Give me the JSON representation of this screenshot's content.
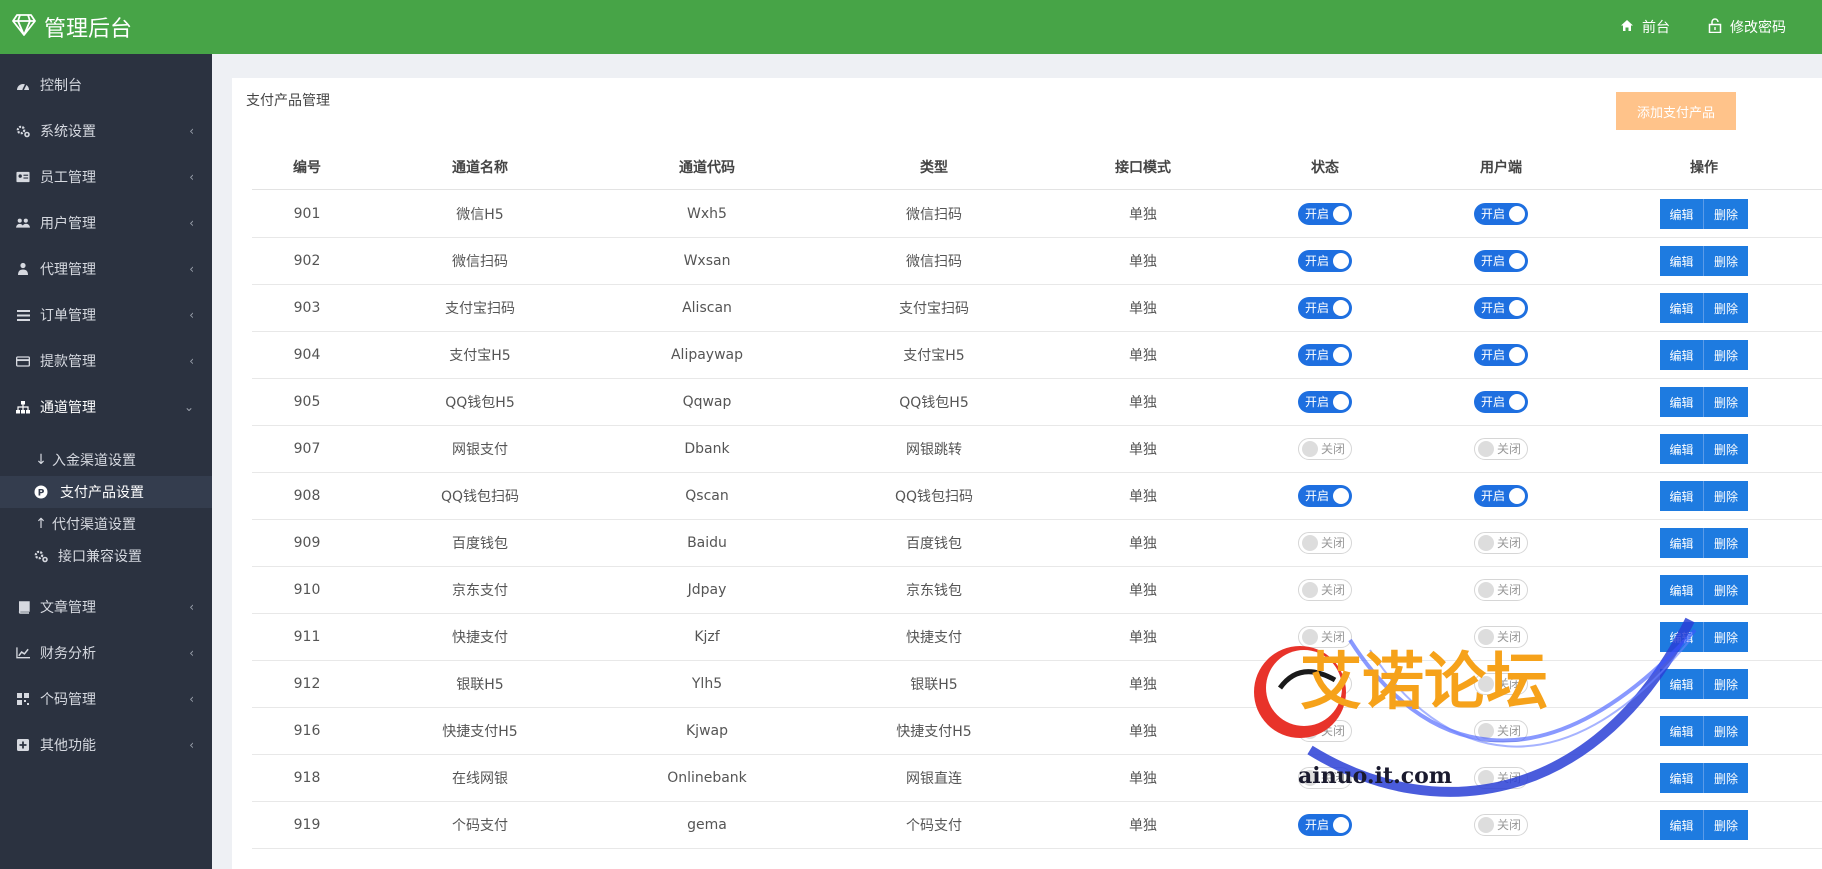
{
  "header": {
    "title": "管理后台",
    "links": {
      "front": "前台",
      "password": "修改密码"
    },
    "color": "#47a447"
  },
  "sidebar": {
    "items": [
      {
        "label": "控制台",
        "icon": "dashboard-icon"
      },
      {
        "label": "系统设置",
        "icon": "cogs-icon"
      },
      {
        "label": "员工管理",
        "icon": "id-card-icon"
      },
      {
        "label": "用户管理",
        "icon": "users-icon"
      },
      {
        "label": "代理管理",
        "icon": "user-tie-icon"
      },
      {
        "label": "订单管理",
        "icon": "list-icon"
      },
      {
        "label": "提款管理",
        "icon": "credit-card-icon"
      },
      {
        "label": "通道管理",
        "icon": "sitemap-icon"
      },
      {
        "label": "文章管理",
        "icon": "book-icon"
      },
      {
        "label": "财务分析",
        "icon": "line-chart-icon"
      },
      {
        "label": "个码管理",
        "icon": "qrcode-icon"
      },
      {
        "label": "其他功能",
        "icon": "plus-square-icon"
      }
    ],
    "sub_items": [
      {
        "label": "入金渠道设置",
        "icon": "arrow-down-icon"
      },
      {
        "label": "支付产品设置",
        "icon": "p-circle-icon"
      },
      {
        "label": "代付渠道设置",
        "icon": "arrow-up-icon"
      },
      {
        "label": "接口兼容设置",
        "icon": "cogs-icon"
      }
    ]
  },
  "panel": {
    "title": "支付产品管理",
    "add_button": "添加支付产品"
  },
  "table": {
    "headers": [
      "编号",
      "通道名称",
      "通道代码",
      "类型",
      "接口模式",
      "状态",
      "用户端",
      "操作"
    ],
    "on_label": "开启",
    "off_label": "关闭",
    "edit_label": "编辑",
    "delete_label": "删除",
    "rows": [
      {
        "id": "901",
        "name": "微信H5",
        "code": "Wxh5",
        "type": "微信扫码",
        "mode": "单独",
        "status": true,
        "client": true
      },
      {
        "id": "902",
        "name": "微信扫码",
        "code": "Wxsan",
        "type": "微信扫码",
        "mode": "单独",
        "status": true,
        "client": true
      },
      {
        "id": "903",
        "name": "支付宝扫码",
        "code": "Aliscan",
        "type": "支付宝扫码",
        "mode": "单独",
        "status": true,
        "client": true
      },
      {
        "id": "904",
        "name": "支付宝H5",
        "code": "Alipaywap",
        "type": "支付宝H5",
        "mode": "单独",
        "status": true,
        "client": true
      },
      {
        "id": "905",
        "name": "QQ钱包H5",
        "code": "Qqwap",
        "type": "QQ钱包H5",
        "mode": "单独",
        "status": true,
        "client": true
      },
      {
        "id": "907",
        "name": "网银支付",
        "code": "Dbank",
        "type": "网银跳转",
        "mode": "单独",
        "status": false,
        "client": false
      },
      {
        "id": "908",
        "name": "QQ钱包扫码",
        "code": "Qscan",
        "type": "QQ钱包扫码",
        "mode": "单独",
        "status": true,
        "client": true
      },
      {
        "id": "909",
        "name": "百度钱包",
        "code": "Baidu",
        "type": "百度钱包",
        "mode": "单独",
        "status": false,
        "client": false
      },
      {
        "id": "910",
        "name": "京东支付",
        "code": "Jdpay",
        "type": "京东钱包",
        "mode": "单独",
        "status": false,
        "client": false
      },
      {
        "id": "911",
        "name": "快捷支付",
        "code": "Kjzf",
        "type": "快捷支付",
        "mode": "单独",
        "status": false,
        "client": false
      },
      {
        "id": "912",
        "name": "银联H5",
        "code": "Ylh5",
        "type": "银联H5",
        "mode": "单独",
        "status": false,
        "client": false
      },
      {
        "id": "916",
        "name": "快捷支付H5",
        "code": "Kjwap",
        "type": "快捷支付H5",
        "mode": "单独",
        "status": false,
        "client": false
      },
      {
        "id": "918",
        "name": "在线网银",
        "code": "Onlinebank",
        "type": "网银直连",
        "mode": "单独",
        "status": false,
        "client": false
      },
      {
        "id": "919",
        "name": "个码支付",
        "code": "gema",
        "type": "个码支付",
        "mode": "单独",
        "status": true,
        "client": false
      }
    ]
  },
  "watermark": {
    "text": "艾诺论坛",
    "url": "ainuo.it.com"
  },
  "colors": {
    "primary": "#1e7be0",
    "sidebar": "#2b3240",
    "add_button": "#ffc38a"
  }
}
